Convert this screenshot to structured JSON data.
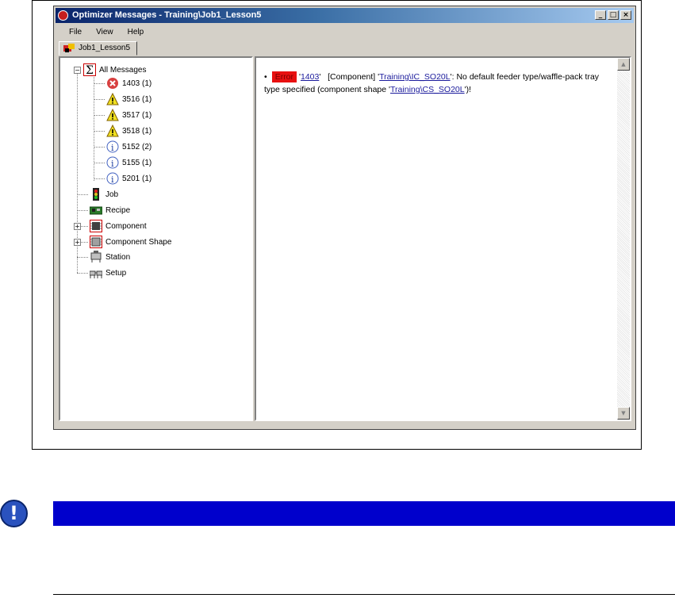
{
  "window": {
    "title": "Optimizer Messages - Training\\Job1_Lesson5",
    "buttons": [
      "_",
      "□",
      "×"
    ]
  },
  "menu": [
    "File",
    "View",
    "Help"
  ],
  "tab": {
    "label": "Job1_Lesson5"
  },
  "tree": {
    "root": {
      "label": "All Messages",
      "icon": "sigma-icon"
    },
    "messages": [
      {
        "label": "1403 (1)",
        "icon": "error-icon"
      },
      {
        "label": "3516 (1)",
        "icon": "warning-icon"
      },
      {
        "label": "3517 (1)",
        "icon": "warning-icon"
      },
      {
        "label": "3518 (1)",
        "icon": "warning-icon"
      },
      {
        "label": "5152 (2)",
        "icon": "info-icon"
      },
      {
        "label": "5155 (1)",
        "icon": "info-icon"
      },
      {
        "label": "5201 (1)",
        "icon": "info-icon"
      }
    ],
    "categories": [
      {
        "label": "Job",
        "icon": "traffic-light-icon"
      },
      {
        "label": "Recipe",
        "icon": "circuit-board-icon"
      },
      {
        "label": "Component",
        "icon": "chip-icon"
      },
      {
        "label": "Component Shape",
        "icon": "chip-shape-icon"
      },
      {
        "label": "Station",
        "icon": "station-icon"
      },
      {
        "label": "Setup",
        "icon": "setup-icon"
      }
    ]
  },
  "message": {
    "severity": "Error",
    "code_link": "1403",
    "category": "[Component]",
    "component_link": "Training\\IC_SO20L",
    "text": ": No default feeder type/waffle-pack tray type specified (component shape '",
    "shape_link": "Training\\CS_SO20L",
    "tail": "')!"
  },
  "colors": {
    "note_bar": "#0000cc",
    "error_badge": "#e81010"
  },
  "note_icon": "!"
}
